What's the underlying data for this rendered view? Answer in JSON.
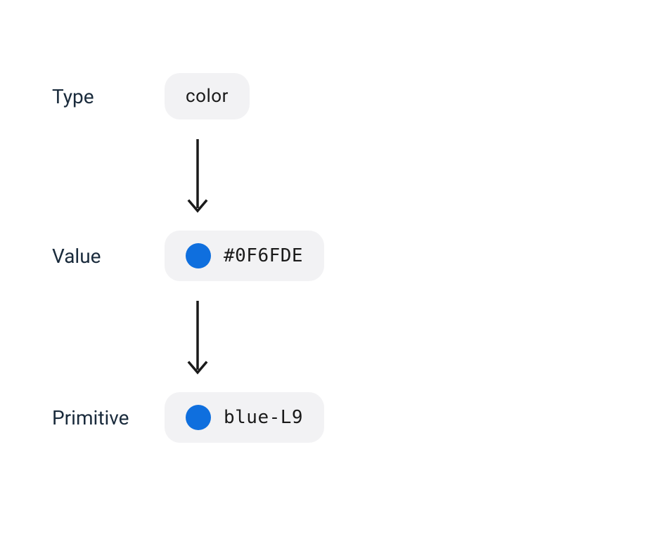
{
  "rows": {
    "type": {
      "label": "Type",
      "pill_text": "color"
    },
    "value": {
      "label": "Value",
      "pill_text": "#0F6FDE",
      "swatch_color": "#0F6FDE"
    },
    "primitive": {
      "label": "Primitive",
      "pill_text": "blue-L9",
      "swatch_color": "#0F6FDE"
    }
  },
  "colors": {
    "label_text": "#1a2b3c",
    "pill_bg": "#f2f2f4",
    "arrow": "#1a1a1a"
  }
}
